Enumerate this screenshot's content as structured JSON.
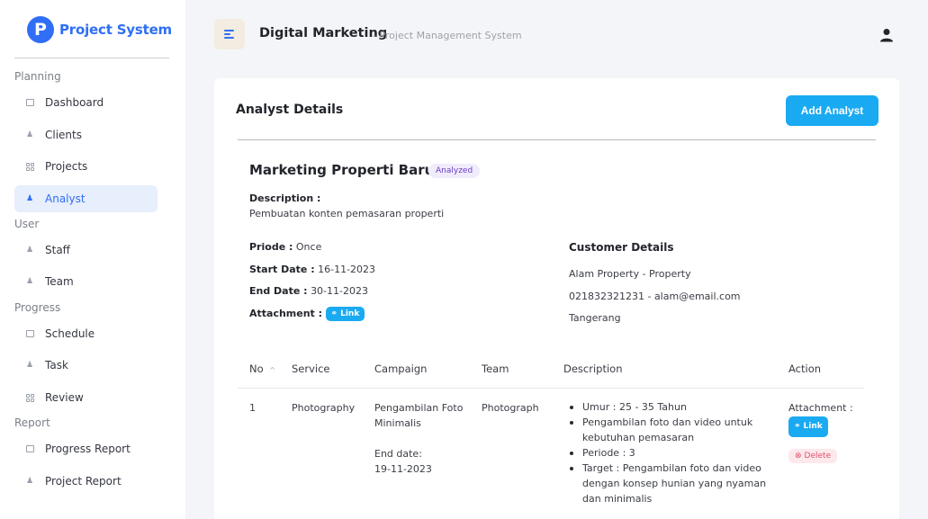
{
  "brand": {
    "logo_letter": "P",
    "name": "Project System",
    "color": "#2f6ef5"
  },
  "sidebar": {
    "sections": [
      {
        "label": "Planning"
      },
      {
        "label": "User"
      },
      {
        "label": "Progress"
      },
      {
        "label": "Report"
      }
    ],
    "items": [
      {
        "label": "Dashboard",
        "icon": "calendar-icon"
      },
      {
        "label": "Clients",
        "icon": "user-plus-icon"
      },
      {
        "label": "Projects",
        "icon": "grid-icon"
      },
      {
        "label": "Analyst",
        "icon": "user-plus-icon",
        "active": true
      },
      {
        "label": "Staff",
        "icon": "user-icon"
      },
      {
        "label": "Team",
        "icon": "users-icon"
      },
      {
        "label": "Schedule",
        "icon": "calendar-icon"
      },
      {
        "label": "Task",
        "icon": "user-plus-icon"
      },
      {
        "label": "Review",
        "icon": "grid-icon"
      },
      {
        "label": "Progress Report",
        "icon": "calendar-icon"
      },
      {
        "label": "Project Report",
        "icon": "user-plus-icon"
      }
    ]
  },
  "header": {
    "title": "Digital Marketing",
    "subtitle": "- Project Management System"
  },
  "card": {
    "title": "Analyst Details",
    "add_button": "Add Analyst"
  },
  "project": {
    "name": "Marketing Properti Baru",
    "status": "Analyzed",
    "description_label": "Description :",
    "description": "Pembuatan konten pemasaran properti",
    "periode_label": "Priode :",
    "periode": "Once",
    "start_label": "Start Date :",
    "start": "16-11-2023",
    "end_label": "End Date :",
    "end": "30-11-2023",
    "attachment_label": "Attachment :",
    "link_label": "Link"
  },
  "customer": {
    "title": "Customer Details",
    "name": "Alam Property - Property",
    "contact": "021832321231 - alam@email.com",
    "city": "Tangerang"
  },
  "table": {
    "headers": {
      "no": "No",
      "service": "Service",
      "campaign": "Campaign",
      "team": "Team",
      "description": "Description",
      "action": "Action"
    },
    "sort_icon": "^",
    "rows": [
      {
        "no": "1",
        "service": "Photography",
        "campaign_1": "Pengambilan Foto",
        "campaign_2": "Minimalis",
        "end_label": "End date:",
        "end_date": "19-11-2023",
        "team": "Photograph",
        "desc_items": [
          "Umur : 25 - 35 Tahun",
          "Pengambilan foto dan video untuk kebutuhan pemasaran",
          "Periode : 3",
          "Target : Pengambilan foto dan video dengan konsep hunian yang nyaman dan minimalis"
        ],
        "attachment_label": "Attachment :",
        "link_label": "Link",
        "delete_label": "Delete"
      }
    ]
  }
}
